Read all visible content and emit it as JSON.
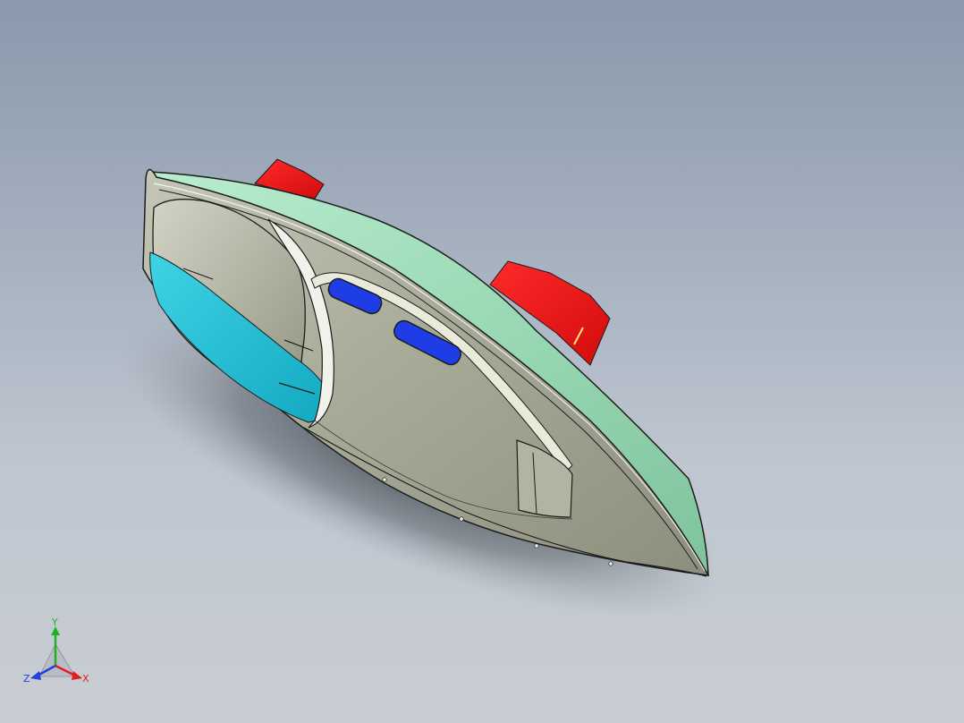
{
  "viewport": {
    "background_top": "#8a99ad",
    "background_bottom": "#c9cdd3"
  },
  "model": {
    "colors": {
      "outer_shell": "#9ad9b4",
      "inner_panel": "#a3a593",
      "cyan_panel": "#1cc1d8",
      "window_inlay": "#1f3de6",
      "fin": "#f21818",
      "edge": "#1c1c1c"
    }
  },
  "triad": {
    "labels": {
      "x": "X",
      "y": "Y",
      "z": "Z"
    },
    "colors": {
      "x": "#e02020",
      "y": "#20b020",
      "z": "#2040e0"
    }
  }
}
